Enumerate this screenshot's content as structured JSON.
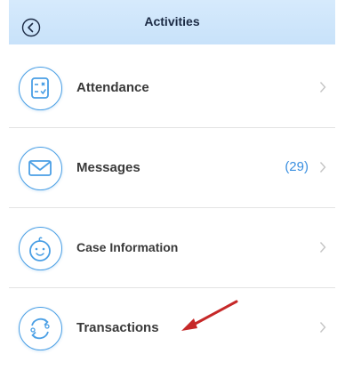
{
  "header": {
    "title": "Activities",
    "back_icon": "back-circle-icon"
  },
  "items": [
    {
      "label": "Attendance",
      "icon": "calendar-check-icon",
      "badge": ""
    },
    {
      "label": "Messages",
      "icon": "envelope-icon",
      "badge": "(29)"
    },
    {
      "label": "Case Information",
      "icon": "baby-face-icon",
      "badge": ""
    },
    {
      "label": "Transactions",
      "icon": "exchange-users-icon",
      "badge": ""
    }
  ],
  "colors": {
    "accent": "#4a9fe5",
    "header_bg": "#d6eafc",
    "badge": "#3a8fe0",
    "annotation_arrow": "#c62828"
  }
}
